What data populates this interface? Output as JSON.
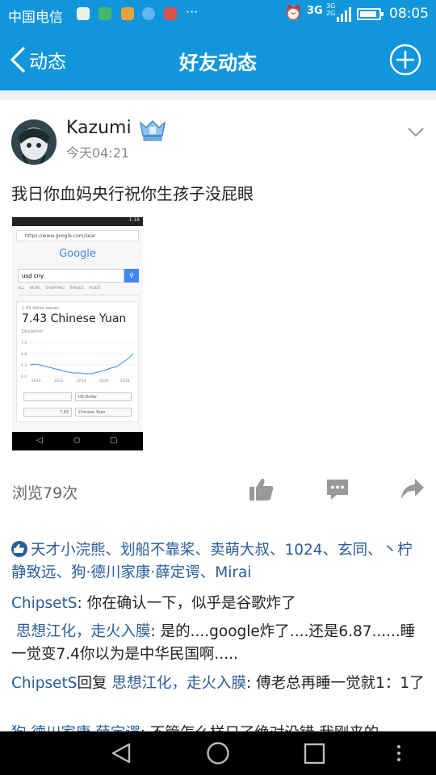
{
  "status_bar": {
    "carrier": "中国电信",
    "dots": "···",
    "network": "3G",
    "network2": "3G\n2G",
    "time": "08:05",
    "battery_level": 0.9,
    "icons": [
      "alarm-icon",
      "signal-icon",
      "battery-icon"
    ]
  },
  "header": {
    "back_label": "动态",
    "title": "好友动态",
    "add_icon": "plus-circle-icon"
  },
  "post": {
    "user_name": "Kazumi",
    "badge_icon": "vip-badge-icon",
    "time": "今天04:21",
    "text": "我日你血妈央行祝你生孩子没屁眼",
    "image": {
      "status_time": "1:18",
      "url": "https://www.google.com/sear",
      "logo": "Google",
      "query": "usd cny",
      "tabs": "ALL NEWS SHOPPING IMAGES VIDEO",
      "result_caption": "1 US Dollar equals",
      "result_value": "7.43 Chinese Yuan",
      "result_sub": "Disclaimer",
      "chart_y_labels": [
        "7.2",
        "6.8",
        "6.4",
        "6.0"
      ],
      "chart_x_labels": [
        "2010",
        "2012",
        "2014",
        "2016",
        "2018"
      ],
      "from_unit": "US Dollar",
      "to_value": "7.43",
      "to_unit": "Chinese Yuan"
    },
    "views": "浏览79次",
    "actions": [
      "like-icon",
      "comment-icon",
      "share-icon"
    ]
  },
  "likers": "天才小浣熊、划船不靠桨、卖萌大叔、1024、玄同、丶柠静致远、狗·德川家康·薛定谔、Mirai",
  "comments": [
    {
      "user": "ChipsetS",
      "sep": ": ",
      "text": "你在确认一下，似乎是谷歌炸了"
    },
    {
      "user": "思想江化，走火入膜",
      "sep": ": ",
      "text": "是的....google炸了....还是6.87......睡一觉变7.4你以为是中华民国啊....."
    },
    {
      "user": "ChipsetS",
      "reply_word": "回复 ",
      "reply_to": "思想江化，走火入膜",
      "sep": ": ",
      "text": "傅老总再睡一觉就1：1了"
    },
    {
      "user": "狗·德川家康·薛定谔",
      "sep": ": ",
      "text": "不管怎么样日了绝对没错 我刚来的"
    }
  ],
  "nav_bar": [
    "back-triangle-icon",
    "home-circle-icon",
    "recents-square-icon",
    "menu-dots-icon"
  ]
}
